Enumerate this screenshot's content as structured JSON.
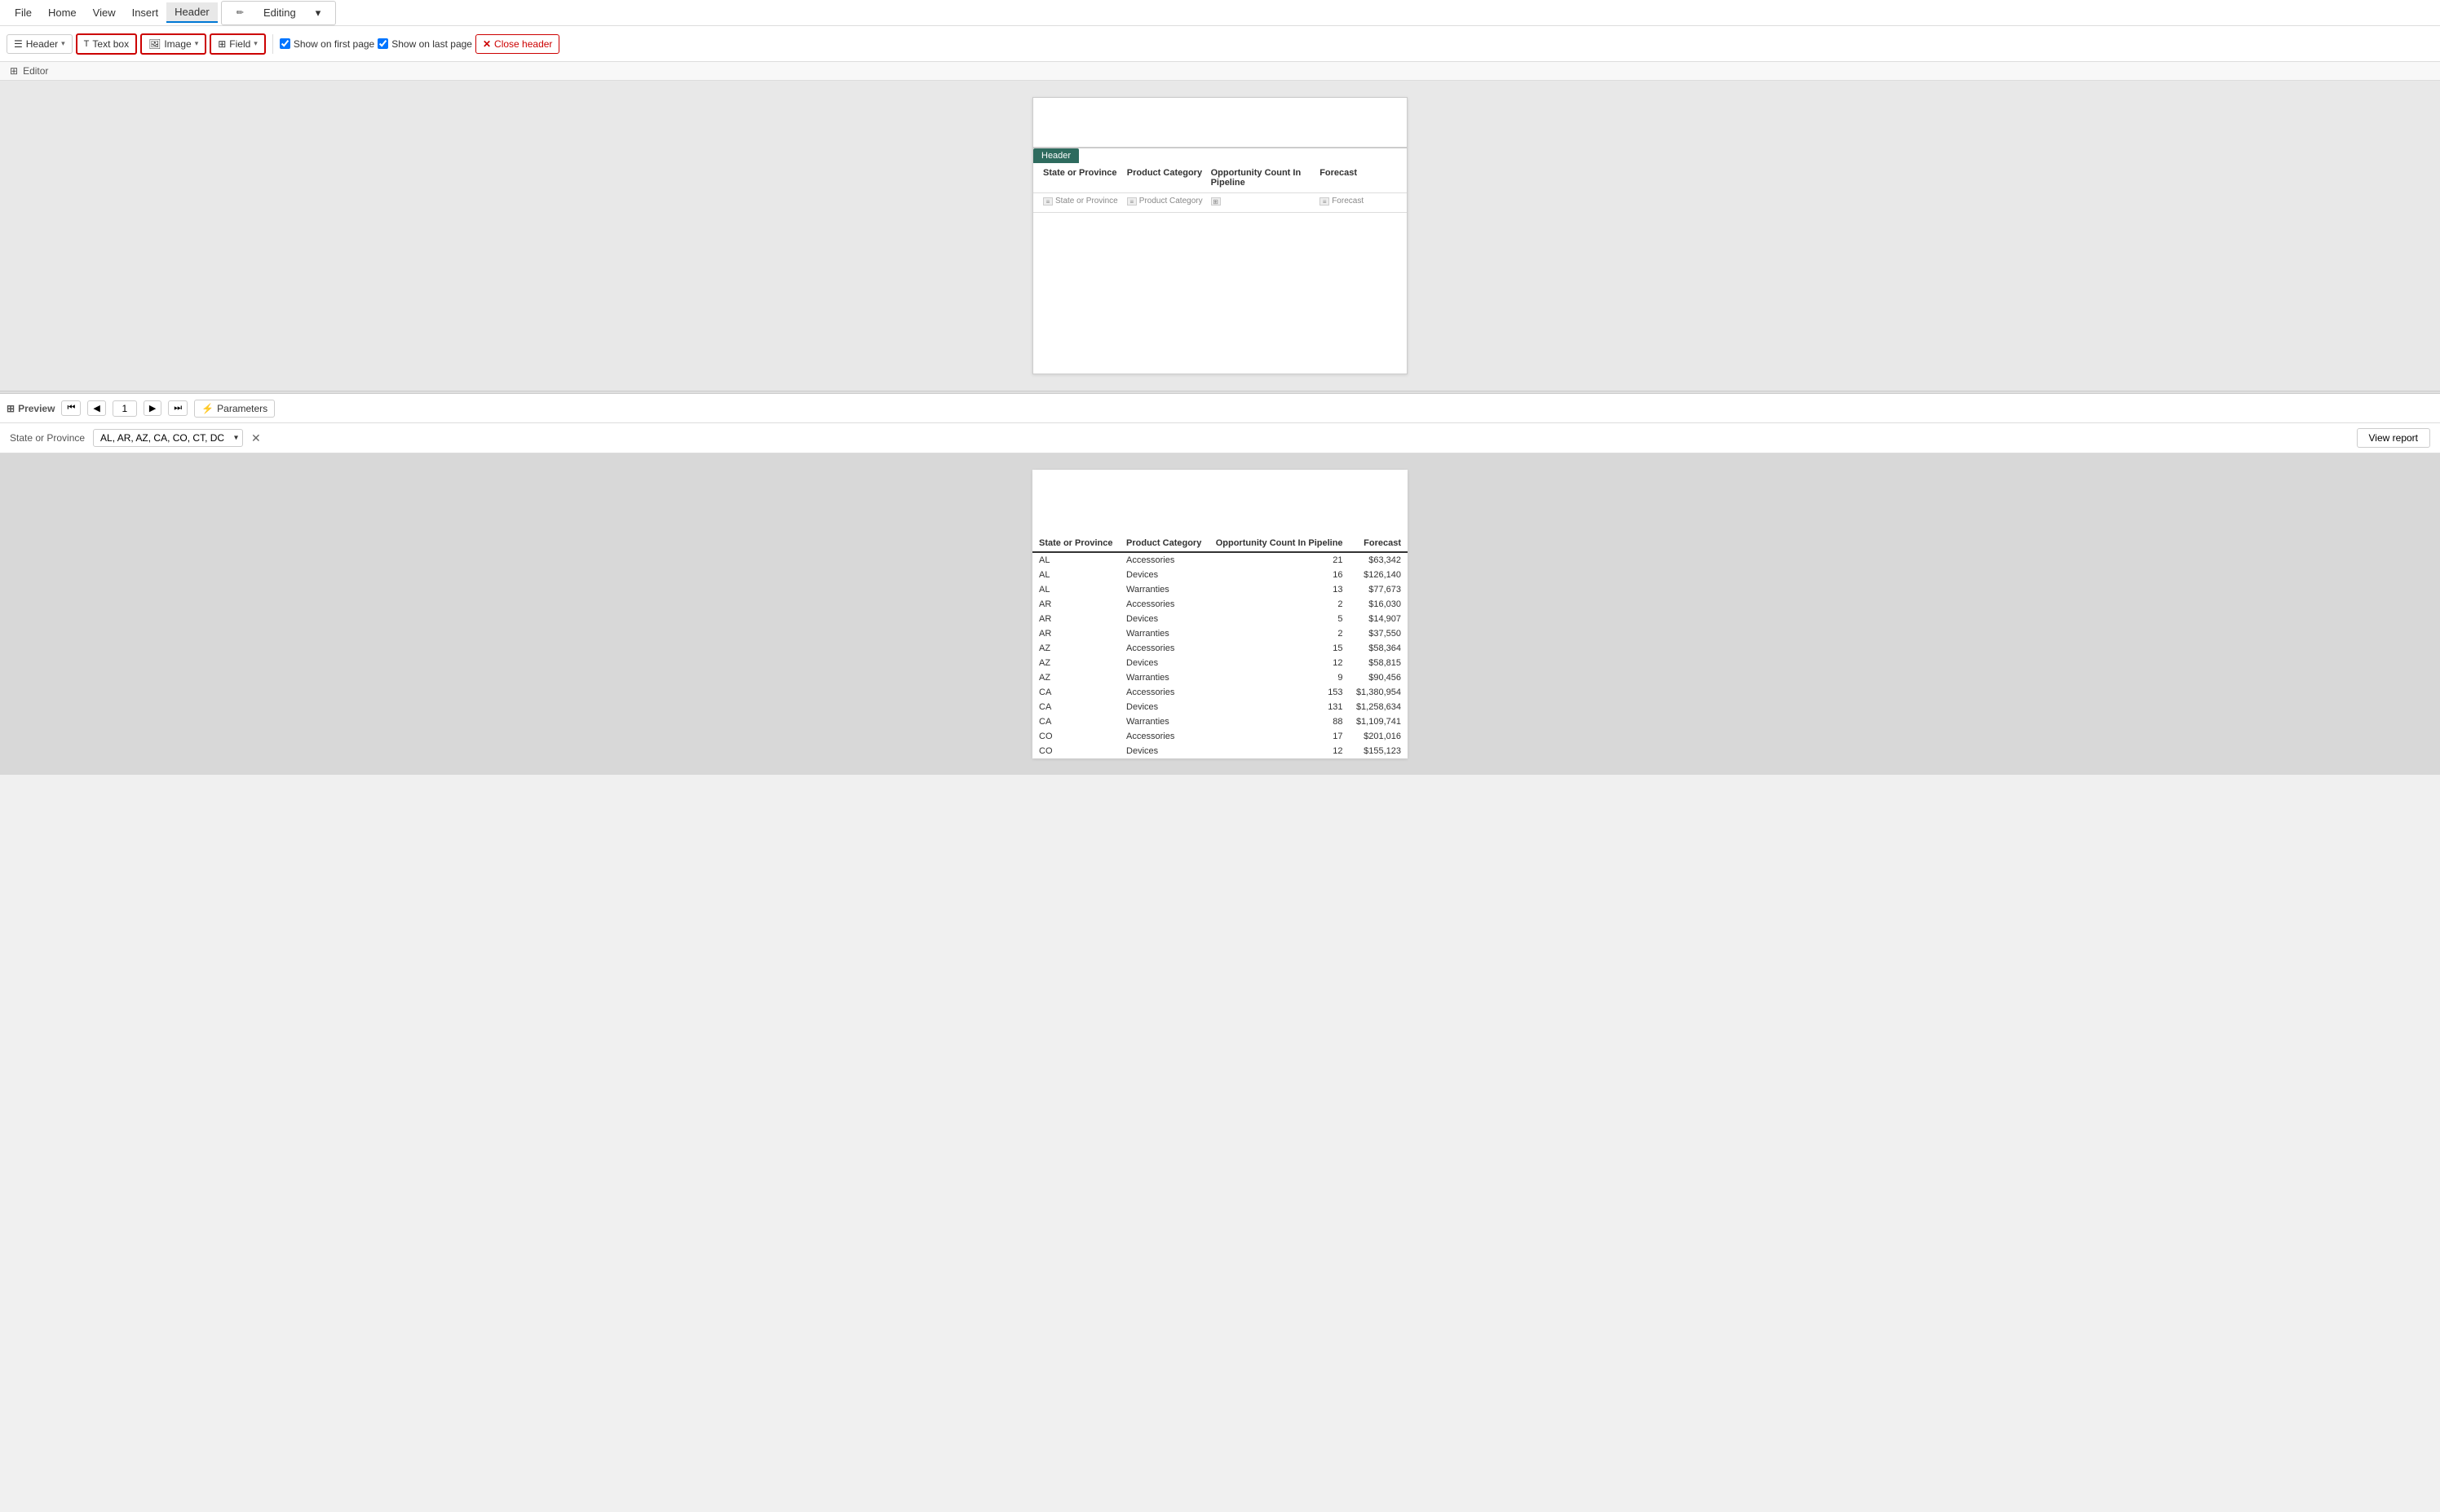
{
  "menuBar": {
    "items": [
      "File",
      "Home",
      "View",
      "Insert",
      "Header"
    ],
    "activeItem": "Header",
    "editingBadge": "Editing"
  },
  "toolbar": {
    "headerBtn": "Header",
    "textBoxBtn": "Text box",
    "imageBtn": "Image",
    "fieldBtn": "Field",
    "showOnFirstPage": "Show on first page",
    "showOnLastPage": "Show on last page",
    "closeHeader": "Close header",
    "showOnFirstChecked": true,
    "showOnLastChecked": true
  },
  "editor": {
    "sectionLabel": "Editor",
    "headerTabLabel": "Header",
    "columns": [
      {
        "title": "State or Province",
        "fieldName": "State or Province"
      },
      {
        "title": "Product Category",
        "fieldName": "Product Category"
      },
      {
        "title": "Opportunity Count In Pipeline",
        "fieldName": ""
      },
      {
        "title": "Forecast",
        "fieldName": "Forecast"
      }
    ]
  },
  "preview": {
    "sectionLabel": "Preview",
    "pageNumber": "1",
    "paramsBtn": "Parameters",
    "paramLabel": "State or Province",
    "paramValue": "AL, AR, AZ, CA, CO, CT, DC",
    "viewReportBtn": "View report",
    "tableHeaders": [
      "State or Province",
      "Product Category",
      "Opportunity Count In Pipeline",
      "Forecast"
    ],
    "tableRows": [
      [
        "AL",
        "Accessories",
        "21",
        "$63,342"
      ],
      [
        "AL",
        "Devices",
        "16",
        "$126,140"
      ],
      [
        "AL",
        "Warranties",
        "13",
        "$77,673"
      ],
      [
        "AR",
        "Accessories",
        "2",
        "$16,030"
      ],
      [
        "AR",
        "Devices",
        "5",
        "$14,907"
      ],
      [
        "AR",
        "Warranties",
        "2",
        "$37,550"
      ],
      [
        "AZ",
        "Accessories",
        "15",
        "$58,364"
      ],
      [
        "AZ",
        "Devices",
        "12",
        "$58,815"
      ],
      [
        "AZ",
        "Warranties",
        "9",
        "$90,456"
      ],
      [
        "CA",
        "Accessories",
        "153",
        "$1,380,954"
      ],
      [
        "CA",
        "Devices",
        "131",
        "$1,258,634"
      ],
      [
        "CA",
        "Warranties",
        "88",
        "$1,109,741"
      ],
      [
        "CO",
        "Accessories",
        "17",
        "$201,016"
      ],
      [
        "CO",
        "Devices",
        "12",
        "$155,123"
      ]
    ]
  }
}
